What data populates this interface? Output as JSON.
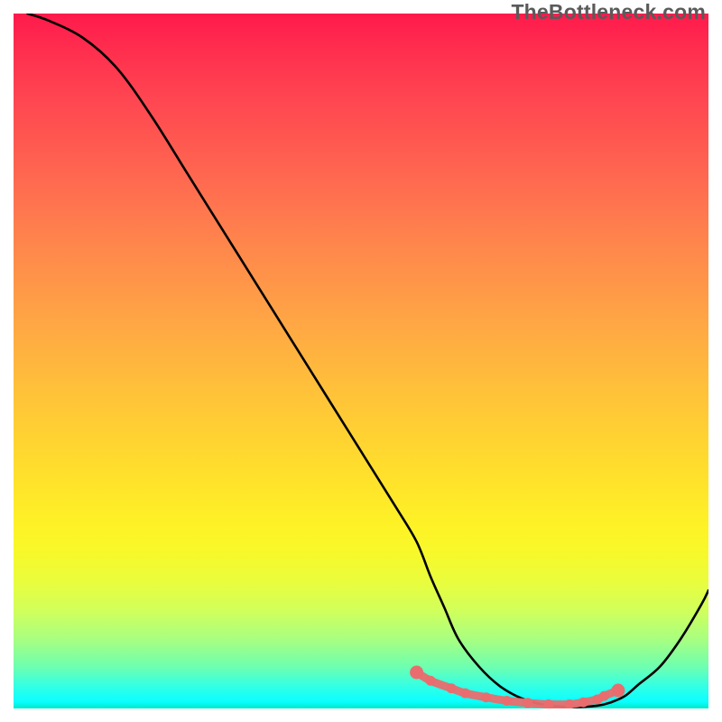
{
  "watermark": "TheBottleneck.com",
  "chart_data": {
    "type": "line",
    "title": "",
    "xlabel": "",
    "ylabel": "",
    "xlim": [
      0,
      100
    ],
    "ylim": [
      0,
      100
    ],
    "series": [
      {
        "name": "bottleneck-curve",
        "x": [
          2,
          5,
          10,
          15,
          20,
          25,
          30,
          35,
          40,
          45,
          50,
          55,
          58,
          60,
          62,
          64,
          67,
          70,
          73,
          76,
          80,
          84,
          86,
          88,
          90,
          93,
          96,
          99,
          100
        ],
        "y": [
          100,
          99,
          96.5,
          92,
          85,
          77,
          69,
          61,
          53,
          45,
          37,
          29,
          24,
          19,
          14.5,
          10,
          6,
          3.2,
          1.5,
          0.6,
          0.2,
          0.4,
          0.9,
          1.8,
          3.5,
          6,
          10,
          15,
          17
        ]
      }
    ],
    "markers": {
      "color": "#e96d6e",
      "points_x": [
        58,
        60,
        63,
        65,
        68,
        71,
        74,
        77,
        80,
        82,
        84,
        85,
        87
      ],
      "points_y": [
        5.2,
        4.0,
        2.9,
        2.2,
        1.6,
        1.1,
        0.8,
        0.6,
        0.6,
        0.9,
        1.3,
        1.8,
        2.6
      ]
    },
    "background_gradient": {
      "top": "#ff1a4c",
      "mid": "#ffd033",
      "bottom": "#00e8ca"
    }
  }
}
